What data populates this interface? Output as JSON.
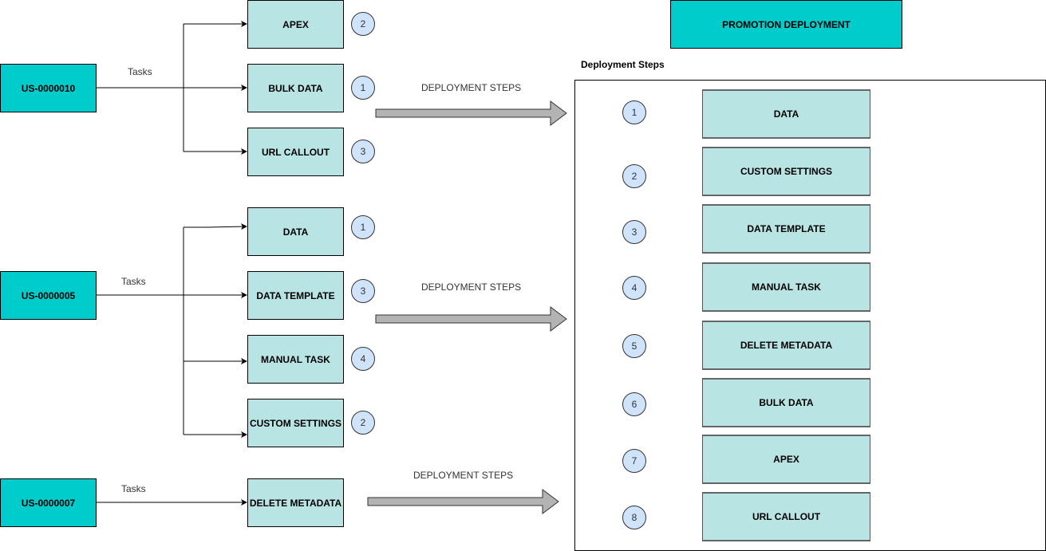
{
  "title": "PROMOTION DEPLOYMENT",
  "deployment_steps_heading": "Deployment Steps",
  "arrow_label": "DEPLOYMENT STEPS",
  "connector_label": "Tasks",
  "colors": {
    "story_fill": "#00cccc",
    "task_fill": "#b9e4e4",
    "badge_fill": "#cfe3fb",
    "arrow_fill": "#b3b3b3"
  },
  "user_stories": [
    {
      "id": "US-0000010",
      "tasks": [
        {
          "label": "APEX",
          "order": "2"
        },
        {
          "label": "BULK DATA",
          "order": "1"
        },
        {
          "label": "URL CALLOUT",
          "order": "3"
        }
      ]
    },
    {
      "id": "US-0000005",
      "tasks": [
        {
          "label": "DATA",
          "order": "1"
        },
        {
          "label": "DATA TEMPLATE",
          "order": "3"
        },
        {
          "label": "MANUAL TASK",
          "order": "4"
        },
        {
          "label": "CUSTOM SETTINGS",
          "order": "2"
        }
      ]
    },
    {
      "id": "US-0000007",
      "tasks": [
        {
          "label": "DELETE METADATA",
          "order": ""
        }
      ]
    }
  ],
  "promotion_steps": [
    {
      "order": "1",
      "label": "DATA"
    },
    {
      "order": "2",
      "label": "CUSTOM SETTINGS"
    },
    {
      "order": "3",
      "label": "DATA TEMPLATE"
    },
    {
      "order": "4",
      "label": "MANUAL TASK"
    },
    {
      "order": "5",
      "label": "DELETE METADATA"
    },
    {
      "order": "6",
      "label": "BULK DATA"
    },
    {
      "order": "7",
      "label": "APEX"
    },
    {
      "order": "8",
      "label": "URL CALLOUT"
    }
  ]
}
